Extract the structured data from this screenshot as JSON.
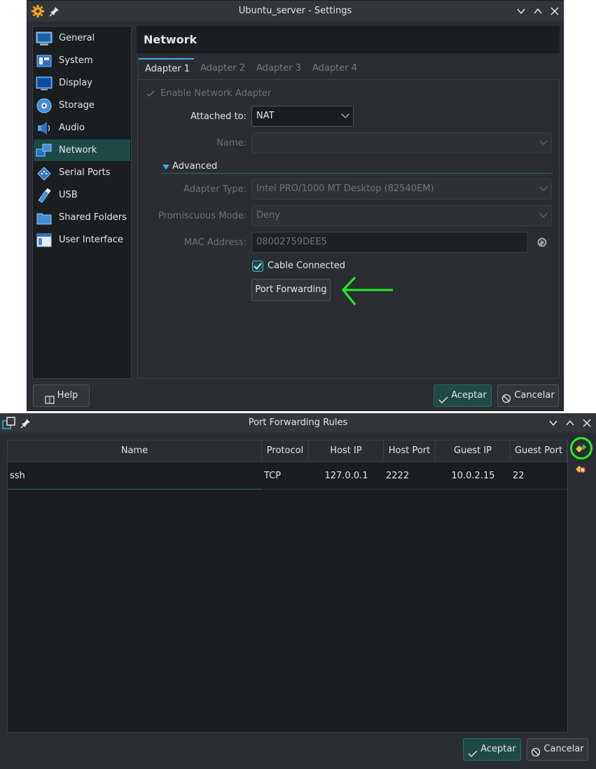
{
  "settings_window": {
    "title": "Ubuntu_server - Settings",
    "sidebar": [
      {
        "label": "General",
        "icon": "general-icon"
      },
      {
        "label": "System",
        "icon": "system-icon"
      },
      {
        "label": "Display",
        "icon": "display-icon"
      },
      {
        "label": "Storage",
        "icon": "storage-icon"
      },
      {
        "label": "Audio",
        "icon": "audio-icon"
      },
      {
        "label": "Network",
        "icon": "network-icon"
      },
      {
        "label": "Serial Ports",
        "icon": "serial-ports-icon"
      },
      {
        "label": "USB",
        "icon": "usb-icon"
      },
      {
        "label": "Shared Folders",
        "icon": "shared-folders-icon"
      },
      {
        "label": "User Interface",
        "icon": "user-interface-icon"
      }
    ],
    "page_title": "Network",
    "tabs": [
      "Adapter 1",
      "Adapter 2",
      "Adapter 3",
      "Adapter 4"
    ],
    "enable_adapter_label": "Enable Network Adapter",
    "attached_to": {
      "label": "Attached to:",
      "value": "NAT"
    },
    "name": {
      "label": "Name:",
      "value": ""
    },
    "advanced_label": "Advanced",
    "adapter_type": {
      "label": "Adapter Type:",
      "value": "Intel PRO/1000 MT Desktop (82540EM)"
    },
    "promiscuous_mode": {
      "label": "Promiscuous Mode:",
      "value": "Deny"
    },
    "mac_address": {
      "label": "MAC Address:",
      "value": "08002759DEE5"
    },
    "cable_connected_label": "Cable Connected",
    "port_forwarding_label": "Port Forwarding",
    "help_label": "Help",
    "ok_label": "Aceptar",
    "cancel_label": "Cancelar"
  },
  "port_forwarding_window": {
    "title": "Port Forwarding Rules",
    "columns": [
      "Name",
      "Protocol",
      "Host IP",
      "Host Port",
      "Guest IP",
      "Guest Port"
    ],
    "rows": [
      {
        "name": "ssh",
        "protocol": "TCP",
        "host_ip": "127.0.0.1",
        "host_port": "2222",
        "guest_ip": "10.0.2.15",
        "guest_port": "22"
      }
    ],
    "ok_label": "Aceptar",
    "cancel_label": "Cancelar"
  },
  "annotation_color": "#22ee22",
  "accent_color": "#3daee9"
}
